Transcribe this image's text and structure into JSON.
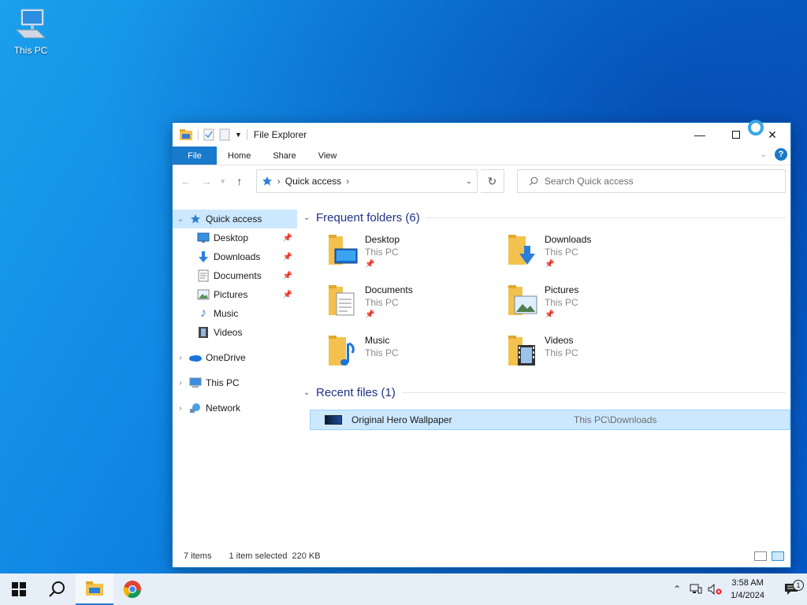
{
  "desktop": {
    "icons": [
      {
        "label": "This PC",
        "icon": "computer-icon"
      }
    ]
  },
  "window": {
    "title": "File Explorer",
    "ribbon_tabs": [
      "File",
      "Home",
      "Share",
      "View"
    ],
    "address": {
      "root_icon": "quick-access-star-icon",
      "location": "Quick access"
    },
    "search_placeholder": "Search Quick access"
  },
  "nav_pane": {
    "quick_access": "Quick access",
    "pinned": [
      {
        "label": "Desktop",
        "icon": "desktop-icon",
        "pinned": true
      },
      {
        "label": "Downloads",
        "icon": "downloads-icon",
        "pinned": true
      },
      {
        "label": "Documents",
        "icon": "documents-icon",
        "pinned": true
      },
      {
        "label": "Pictures",
        "icon": "pictures-icon",
        "pinned": true
      },
      {
        "label": "Music",
        "icon": "music-icon",
        "pinned": false
      },
      {
        "label": "Videos",
        "icon": "videos-icon",
        "pinned": false
      }
    ],
    "roots": [
      {
        "label": "OneDrive",
        "icon": "onedrive-icon"
      },
      {
        "label": "This PC",
        "icon": "this-pc-icon"
      },
      {
        "label": "Network",
        "icon": "network-icon"
      }
    ]
  },
  "content": {
    "frequent_header": "Frequent folders (6)",
    "frequent": [
      {
        "name": "Desktop",
        "location": "This PC",
        "pinned": true,
        "overlay": "desktop"
      },
      {
        "name": "Downloads",
        "location": "This PC",
        "pinned": true,
        "overlay": "downloads"
      },
      {
        "name": "Documents",
        "location": "This PC",
        "pinned": true,
        "overlay": "documents"
      },
      {
        "name": "Pictures",
        "location": "This PC",
        "pinned": true,
        "overlay": "pictures"
      },
      {
        "name": "Music",
        "location": "This PC",
        "pinned": false,
        "overlay": "music"
      },
      {
        "name": "Videos",
        "location": "This PC",
        "pinned": false,
        "overlay": "videos"
      }
    ],
    "recent_header": "Recent files (1)",
    "recent": [
      {
        "name": "Original Hero Wallpaper",
        "path": "This PC\\Downloads"
      }
    ]
  },
  "status": {
    "items": "7 items",
    "selected": "1 item selected",
    "size": "220 KB"
  },
  "taskbar": {
    "apps": [
      "start-icon",
      "search-icon",
      "file-explorer-icon",
      "chrome-icon"
    ],
    "time": "3:58 AM",
    "date": "1/4/2024",
    "notification_count": "1"
  },
  "colors": {
    "accent": "#1979ca",
    "selection": "#cce8ff",
    "group_header": "#1e3287"
  }
}
